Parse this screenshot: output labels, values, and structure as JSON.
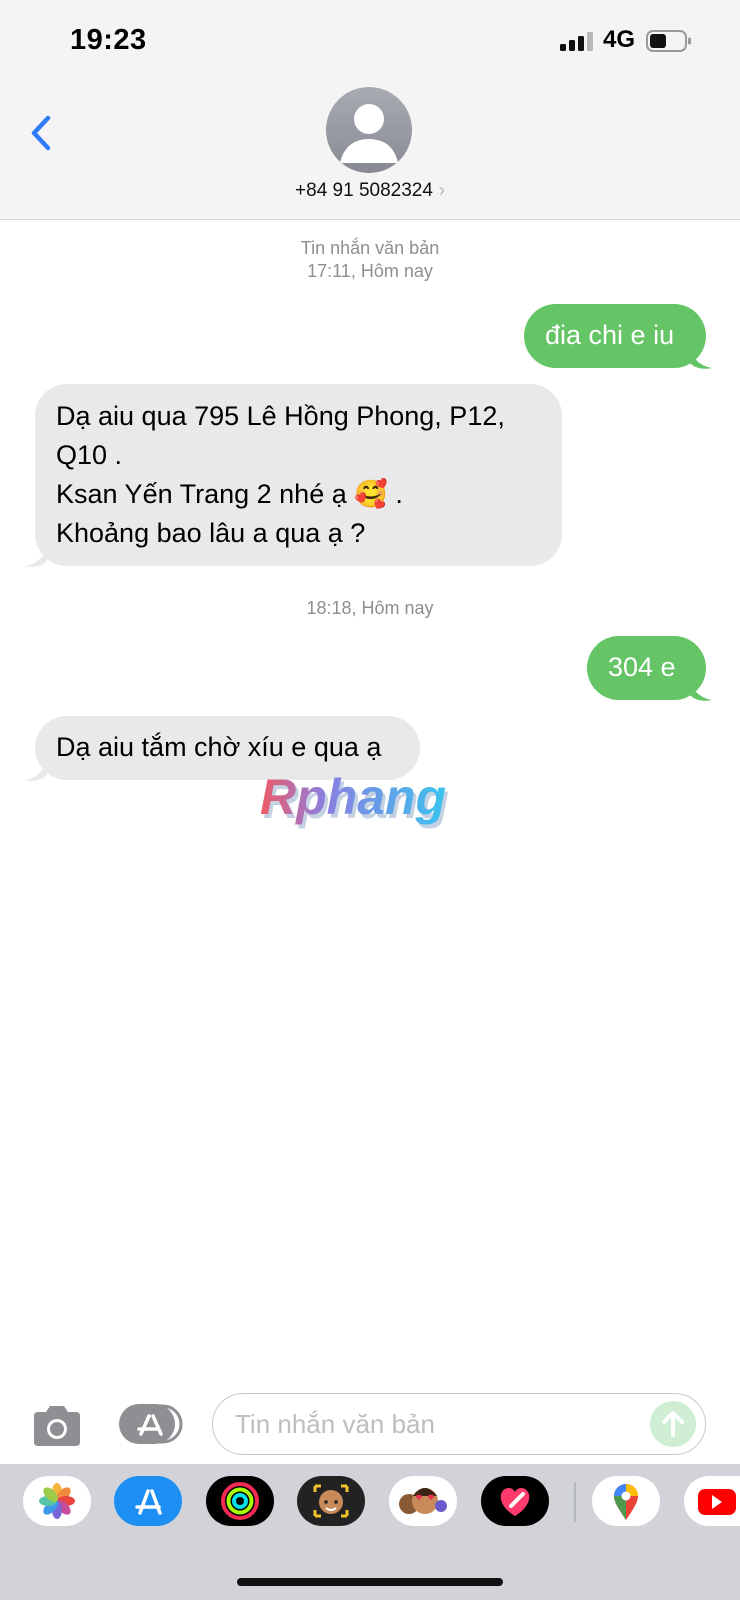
{
  "status_bar": {
    "time": "19:23",
    "network": "4G"
  },
  "header": {
    "contact": "+84 91 5082324",
    "chevron": "›"
  },
  "messages_area": {
    "timestamp_1": {
      "label": "Tin nhắn văn bản",
      "time": "17:11,",
      "day": "Hôm nay"
    },
    "sent_1": "đia chi e iu",
    "received_1": {
      "line1": "Dạ aiu qua 795 Lê Hồng Phong, P12,",
      "line2": "Q10 .",
      "line3_text": "Ksan Yến Trang 2 nhé ạ ",
      "line3_emoji": "🥰",
      "line3_end": " .",
      "line4": "Khoảng bao lâu a qua ạ ?"
    },
    "timestamp_2": {
      "time": "18:18,",
      "day": "Hôm nay"
    },
    "sent_2": "304 e",
    "received_2": "Dạ aiu tắm chờ xíu e qua ạ"
  },
  "watermark": "Rphang",
  "composer": {
    "placeholder": "Tin nhắn văn bản",
    "value": ""
  },
  "app_tray": {
    "apps": [
      "photos-icon",
      "app-store-icon",
      "activity-icon",
      "memoji-icon",
      "animoji-icon",
      "digital-touch-icon",
      "maps-icon",
      "youtube-icon"
    ]
  },
  "colors": {
    "sent_bubble": "#65c466",
    "received_bubble": "#e9e9eb",
    "accent": "#2f7cf6"
  }
}
